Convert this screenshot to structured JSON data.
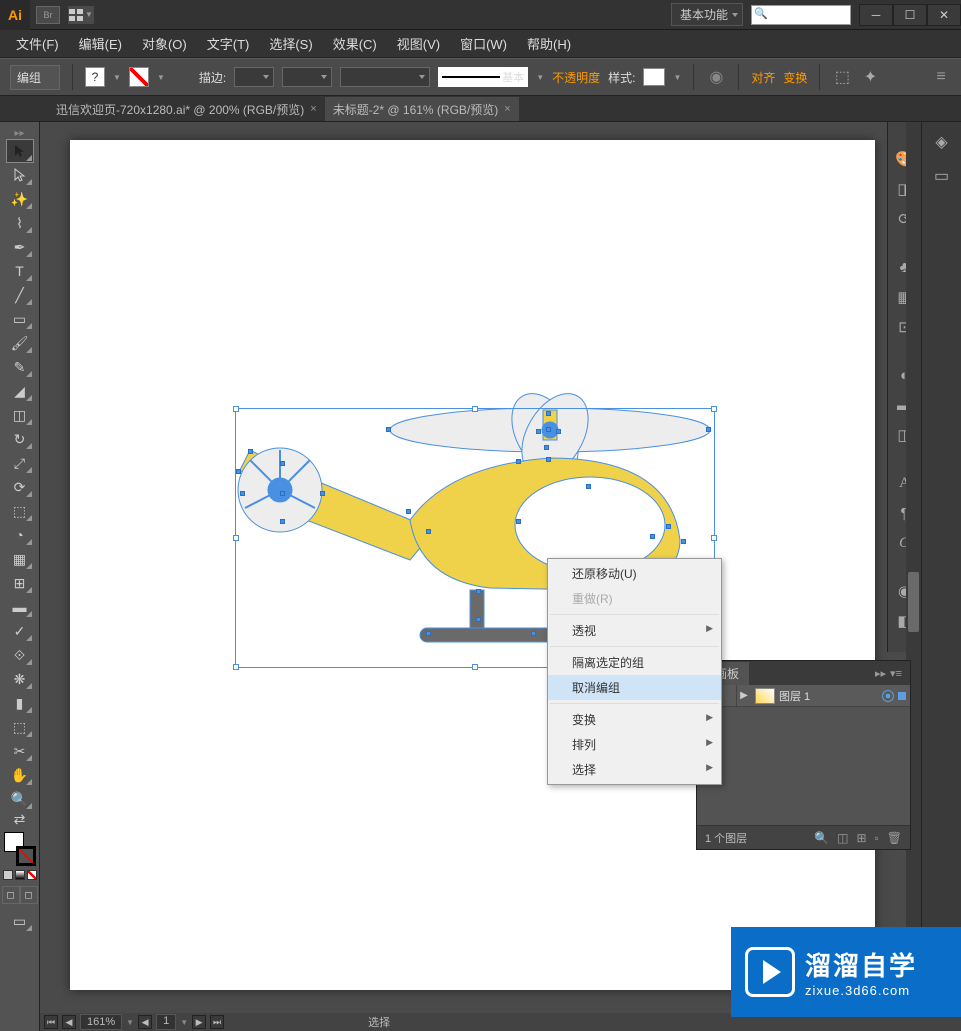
{
  "app": {
    "logo": "Ai",
    "br": "Br"
  },
  "workspace": "基本功能",
  "search_placeholder": "",
  "menu": {
    "file": "文件(F)",
    "edit": "编辑(E)",
    "object": "对象(O)",
    "type": "文字(T)",
    "select": "选择(S)",
    "effect": "效果(C)",
    "view": "视图(V)",
    "window": "窗口(W)",
    "help": "帮助(H)"
  },
  "controlbar": {
    "selection": "编组",
    "stroke_label": "描边:",
    "stroke_style": "基本",
    "opacity": "不透明度",
    "style": "样式:",
    "align": "对齐",
    "transform": "变换"
  },
  "tabs": [
    {
      "label": "迅信欢迎页-720x1280.ai* @ 200% (RGB/预览)",
      "active": false
    },
    {
      "label": "未标题-2* @ 161% (RGB/预览)",
      "active": true
    }
  ],
  "context_menu": {
    "undo": "还原移动(U)",
    "redo": "重做(R)",
    "perspective": "透视",
    "isolate": "隔离选定的组",
    "ungroup": "取消编组",
    "transform": "变换",
    "arrange": "排列",
    "select": "选择"
  },
  "layers": {
    "title": "画板",
    "layer_name": "图层 1",
    "count": "1 个图层"
  },
  "status": {
    "zoom": "161%",
    "artboard": "1",
    "mode": "选择"
  },
  "watermark": {
    "title": "溜溜自学",
    "sub": "zixue.3d66.com"
  }
}
